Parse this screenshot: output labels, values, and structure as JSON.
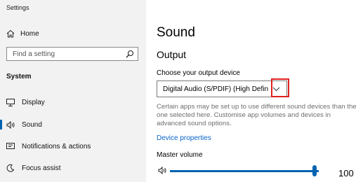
{
  "app": {
    "title": "Settings"
  },
  "sidebar": {
    "home_label": "Home",
    "search_placeholder": "Find a setting",
    "section_title": "System",
    "items": [
      {
        "label": "Display",
        "icon": "monitor-icon"
      },
      {
        "label": "Sound",
        "icon": "speaker-icon",
        "active": true
      },
      {
        "label": "Notifications & actions",
        "icon": "notification-icon"
      },
      {
        "label": "Focus assist",
        "icon": "moon-icon"
      }
    ]
  },
  "main": {
    "page_title": "Sound",
    "section_title": "Output",
    "device_label": "Choose your output device",
    "device_value": "Digital Audio (S/PDIF) (High Definiti...",
    "description": "Certain apps may be set up to use different sound devices than the one selected here. Customise app volumes and devices in advanced sound options.",
    "device_properties_link": "Device properties",
    "master_volume_label": "Master volume",
    "master_volume_value": "100"
  },
  "colors": {
    "accent": "#0063b1",
    "link": "#0a63c9",
    "highlight": "#e02020",
    "sidebar_bg": "#f2f2f2"
  }
}
